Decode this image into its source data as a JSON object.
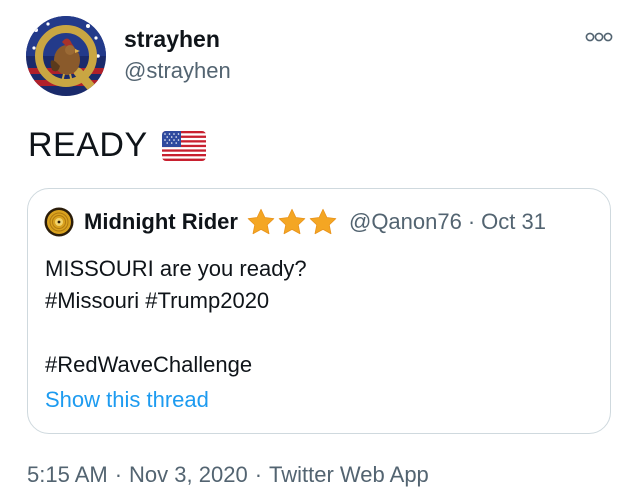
{
  "author": {
    "name": "strayhen",
    "handle": "@strayhen",
    "avatar_icon": "q-logo-rooster-avatar-icon"
  },
  "more_icon": "more-options-icon",
  "tweet_text": "READY",
  "tweet_emoji": "us-flag-icon",
  "quoted": {
    "name": "Midnight Rider",
    "avatar_icon": "gold-record-avatar-icon",
    "stars_icon": "star-icon",
    "star_count": 3,
    "handle": "@Qanon76",
    "separator": "·",
    "date": "Oct 31",
    "lines": [
      "MISSOURI are you ready?",
      "#Missouri #Trump2020",
      "",
      "#RedWaveChallenge"
    ],
    "show_thread": "Show this thread"
  },
  "meta": {
    "time": "5:15 AM",
    "date": "Nov 3, 2020",
    "source": "Twitter Web App",
    "separator": "·"
  },
  "colors": {
    "text": "#0f1419",
    "secondary": "#536471",
    "link": "#1d9bf0",
    "border": "#cfd9de",
    "star": "#f4a623"
  }
}
